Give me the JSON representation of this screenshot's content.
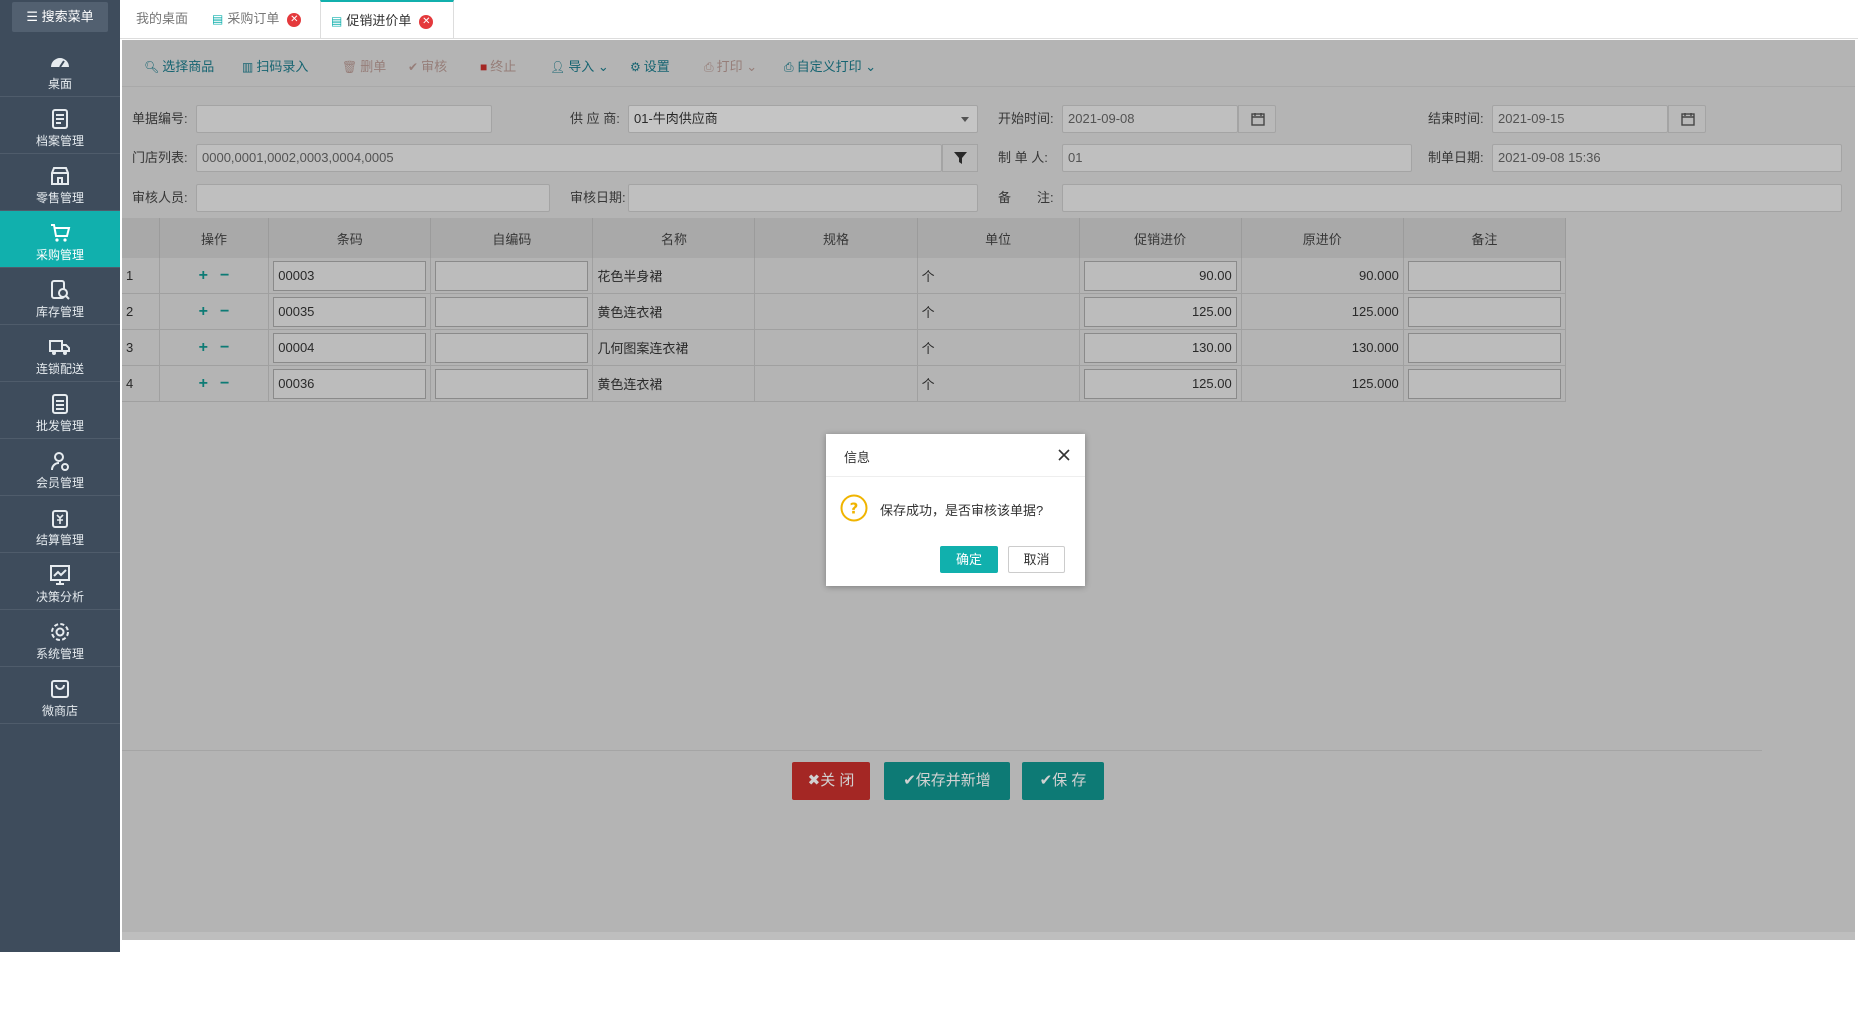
{
  "sidebar": {
    "search_label": "搜索菜单",
    "items": [
      {
        "label": "桌面",
        "icon": "dashboard-icon"
      },
      {
        "label": "档案管理",
        "icon": "archive-icon"
      },
      {
        "label": "零售管理",
        "icon": "store-icon"
      },
      {
        "label": "采购管理",
        "icon": "cart-icon"
      },
      {
        "label": "库存管理",
        "icon": "inventory-search-icon"
      },
      {
        "label": "连锁配送",
        "icon": "truck-icon"
      },
      {
        "label": "批发管理",
        "icon": "wholesale-icon"
      },
      {
        "label": "会员管理",
        "icon": "member-icon"
      },
      {
        "label": "结算管理",
        "icon": "settlement-icon"
      },
      {
        "label": "决策分析",
        "icon": "analytics-icon"
      },
      {
        "label": "系统管理",
        "icon": "gear-icon"
      },
      {
        "label": "微商店",
        "icon": "shop-bag-icon"
      }
    ],
    "active_index": 3
  },
  "tabs": [
    {
      "label": "我的桌面"
    },
    {
      "label": "采购订单"
    },
    {
      "label": "促销进价单"
    }
  ],
  "toolbar": {
    "select_goods": "选择商品",
    "scan_entry": "扫码录入",
    "delete": "删单",
    "audit": "审核",
    "terminate": "终止",
    "import": "导入",
    "settings": "设置",
    "print": "打印",
    "custom_print": "自定义打印"
  },
  "form": {
    "bill_no_label": "单据编号:",
    "bill_no": "",
    "supplier_label": "供 应 商:",
    "supplier": "01-牛肉供应商",
    "start_label": "开始时间:",
    "start": "2021-09-08",
    "end_label": "结束时间:",
    "end": "2021-09-15",
    "stores_label": "门店列表:",
    "stores": "0000,0001,0002,0003,0004,0005",
    "maker_label": "制 单 人:",
    "maker": "01",
    "make_date_label": "制单日期:",
    "make_date": "2021-09-08 15:36",
    "auditor_label": "审核人员:",
    "auditor": "",
    "audit_date_label": "审核日期:",
    "audit_date": "",
    "remark_label": "备　　注:",
    "remark": ""
  },
  "grid": {
    "headers": [
      "",
      "操作",
      "条码",
      "自编码",
      "名称",
      "规格",
      "单位",
      "促销进价",
      "原进价",
      "备注"
    ],
    "rows": [
      {
        "no": "1",
        "barcode": "00003",
        "selfcode": "",
        "name": "花色半身裙",
        "spec": "",
        "unit": "个",
        "promo_price": "90.00",
        "orig_price": "90.000",
        "remark": ""
      },
      {
        "no": "2",
        "barcode": "00035",
        "selfcode": "",
        "name": "黄色连衣裙",
        "spec": "",
        "unit": "个",
        "promo_price": "125.00",
        "orig_price": "125.000",
        "remark": ""
      },
      {
        "no": "3",
        "barcode": "00004",
        "selfcode": "",
        "name": "几何图案连衣裙",
        "spec": "",
        "unit": "个",
        "promo_price": "130.00",
        "orig_price": "130.000",
        "remark": ""
      },
      {
        "no": "4",
        "barcode": "00036",
        "selfcode": "",
        "name": "黄色连衣裙",
        "spec": "",
        "unit": "个",
        "promo_price": "125.00",
        "orig_price": "125.000",
        "remark": ""
      }
    ],
    "plus": "+",
    "minus": "−"
  },
  "buttons": {
    "close": "✖关 闭",
    "save_new": "✔保存并新增",
    "save": "✔保 存"
  },
  "dialog": {
    "title": "信息",
    "message": "保存成功，是否审核该单据?",
    "ok": "确定",
    "cancel": "取消"
  },
  "colors": {
    "accent": "#11b0ad",
    "sidebar_bg": "#3e4c5c",
    "danger": "#c9302c"
  }
}
